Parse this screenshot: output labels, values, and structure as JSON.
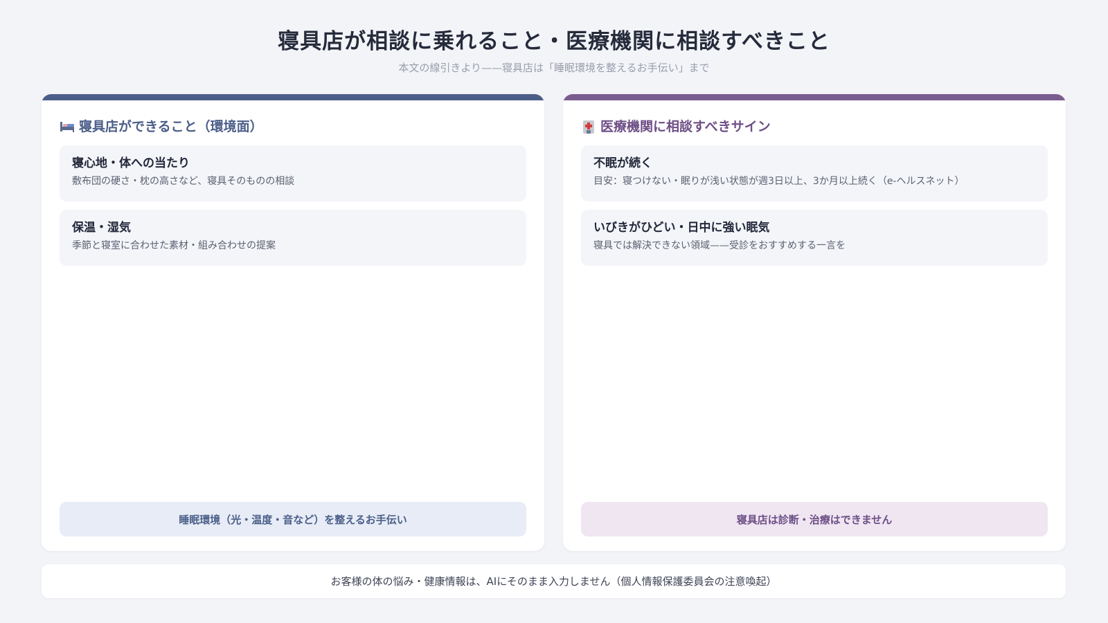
{
  "header": {
    "title": "寝具店が相談に乗れること・医療機関に相談すべきこと",
    "subtitle": "本文の線引きより——寝具店は「睡眠環境を整えるお手伝い」まで"
  },
  "left_panel": {
    "icon": "bed-icon",
    "accent_color": "#4b5e88",
    "heading": "寝具店ができること（環境面）",
    "cards": [
      {
        "title": "寝心地・体への当たり",
        "desc": "敷布団の硬さ・枕の高さなど、寝具そのものの相談"
      },
      {
        "title": "保温・湿気",
        "desc": "季節と寝室に合わせた素材・組み合わせの提案"
      }
    ],
    "footer": "睡眠環境（光・温度・音など）を整えるお手伝い"
  },
  "right_panel": {
    "icon": "hospital-icon",
    "accent_color": "#7a5d8f",
    "heading": "医療機関に相談すべきサイン",
    "cards": [
      {
        "title": "不眠が続く",
        "desc": "目安：寝つけない・眠りが浅い状態が週3日以上、3か月以上続く（e-ヘルスネット）"
      },
      {
        "title": "いびきがひどい・日中に強い眠気",
        "desc": "寝具では解決できない領域——受診をおすすめする一言を"
      }
    ],
    "footer": "寝具店は診断・治療はできません"
  },
  "note": "お客様の体の悩み・健康情報は、AIにそのまま入力しません（個人情報保護委員会の注意喚起）"
}
